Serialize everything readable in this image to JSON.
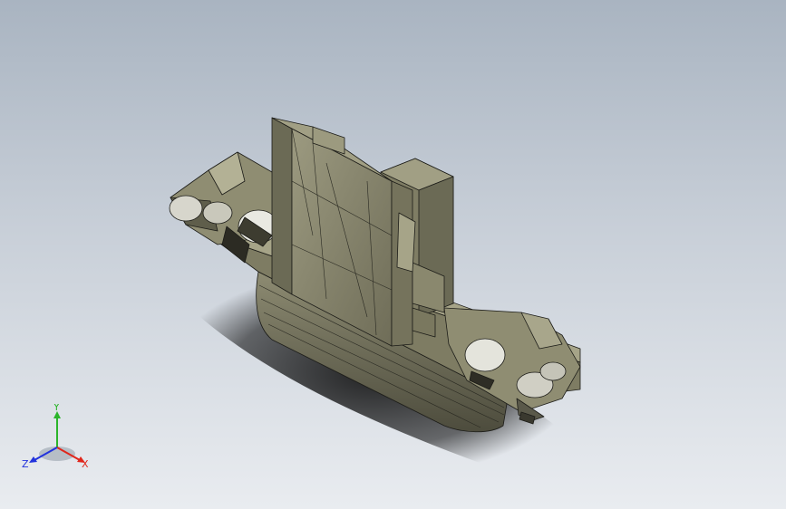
{
  "viewport": {
    "background_top": "#a9b4c1",
    "background_bottom": "#e9ecf0",
    "model_color": "#8d8b70",
    "model_edge_color": "#1c1c18"
  },
  "triad": {
    "x_label": "X",
    "y_label": "Y",
    "z_label": "Z",
    "x_color": "#e0261b",
    "y_color": "#2bb52b",
    "z_color": "#2233dd"
  }
}
